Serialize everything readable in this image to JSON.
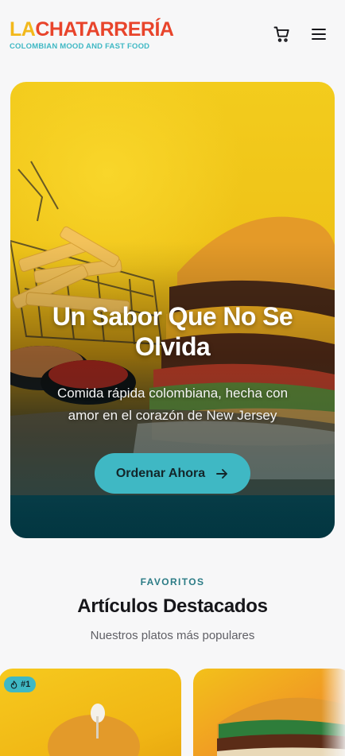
{
  "brand": {
    "logo_la": "LA",
    "logo_chat": "CHATARRERÍA",
    "tagline": "COLOMBIAN MOOD AND FAST FOOD"
  },
  "header": {
    "cart_icon": "cart-icon",
    "menu_icon": "hamburger-menu-icon"
  },
  "hero": {
    "title": "Un Sabor Que No Se Olvida",
    "subtitle": "Comida rápida colombiana, hecha con amor en el corazón de New Jersey",
    "cta_label": "Ordenar Ahora",
    "cta_icon": "arrow-right-icon"
  },
  "featured": {
    "eyebrow": "FAVORITOS",
    "title": "Artículos Destacados",
    "subtitle": "Nuestros platos más populares",
    "cards": [
      {
        "badge": "#1",
        "badge_icon": "flame-icon"
      },
      {}
    ]
  },
  "colors": {
    "accent": "#3fb8c4",
    "brand_yellow": "#f2b81b",
    "brand_red": "#e8442b",
    "eyebrow": "#2c7c86"
  }
}
